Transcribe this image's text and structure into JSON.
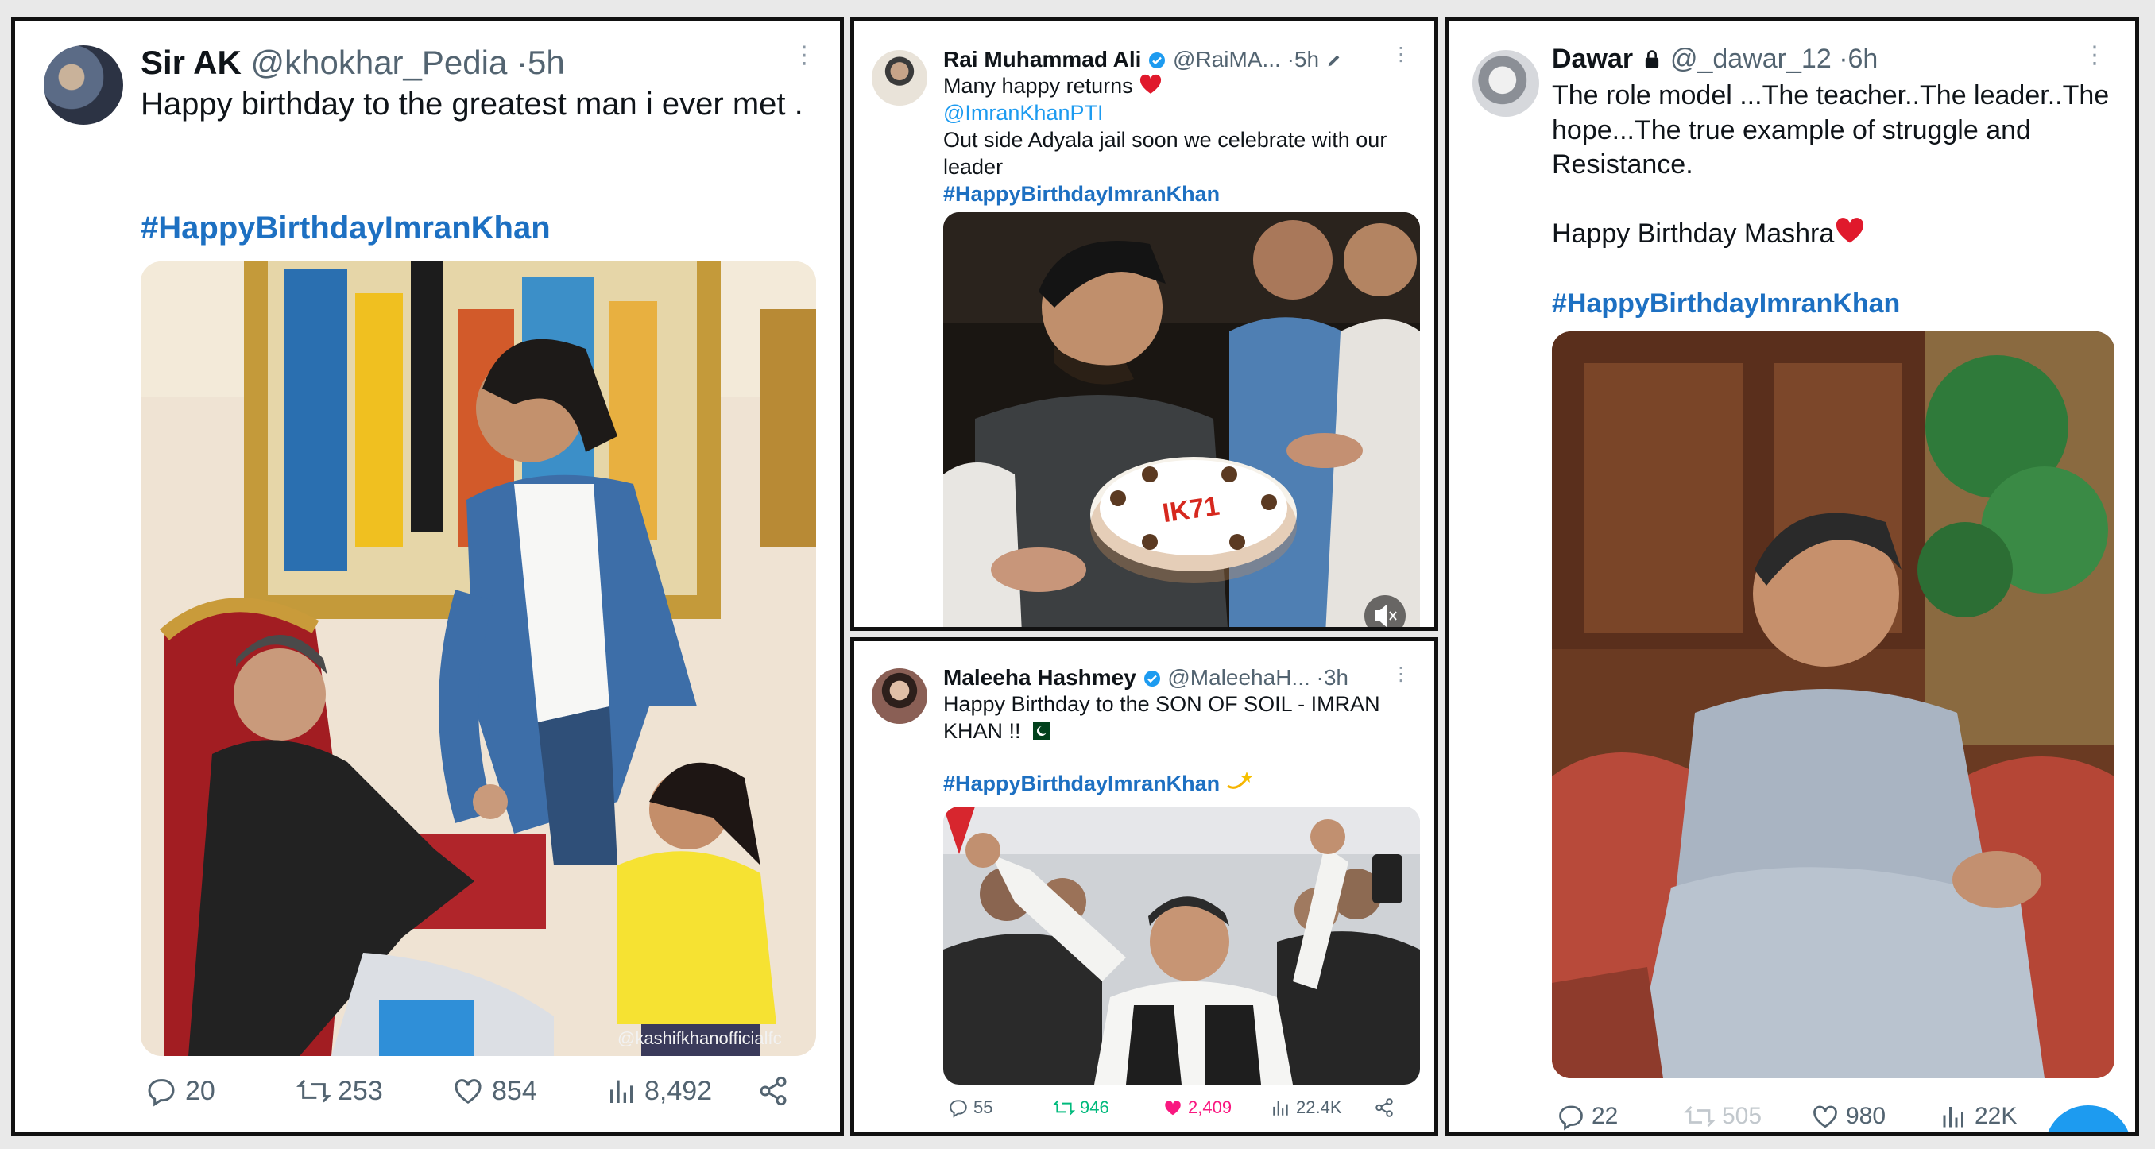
{
  "tweets": [
    {
      "name": "Sir AK",
      "handle": "@khokhar_Pedia",
      "time": "5h",
      "text": "Happy birthday to the greatest man i ever met .",
      "hashtag": "#HappyBirthdayImranKhan",
      "watermark": "@kashifkhanofficialfc",
      "replies": "20",
      "reposts": "253",
      "likes": "854",
      "views": "8,492"
    },
    {
      "name": "Rai Muhammad Ali",
      "handle": "@RaiMA...",
      "time": "5h",
      "line1": "Many happy returns",
      "mention": "@ImranKhanPTI",
      "line2": "Out side Adyala jail soon we celebrate with our leader",
      "hashtag": "#HappyBirthdayImranKhan",
      "cake_text": "IK71"
    },
    {
      "name": "Maleeha Hashmey",
      "handle": "@MaleehaH...",
      "time": "3h",
      "text": "Happy Birthday to the SON OF SOIL - IMRAN KHAN !!",
      "hashtag": "#HappyBirthdayImranKhan",
      "replies": "55",
      "reposts": "946",
      "likes": "2,409",
      "views": "22.4K"
    },
    {
      "name": "Dawar",
      "handle": "@_dawar_12",
      "time": "6h",
      "text": "The role model ...The teacher..The leader..The hope...The true example of struggle and Resistance.",
      "line2": "Happy Birthday Mashra",
      "hashtag": "#HappyBirthdayImranKhan",
      "replies": "22",
      "reposts": "505",
      "likes": "980",
      "views": "22K"
    }
  ],
  "colors": {
    "hashtag": "#1d70c2",
    "mention": "#1d9bf0",
    "verified": "#1d9bf0",
    "like_active": "#f91880",
    "repost_active": "#00ba7c",
    "muted": "#536471"
  }
}
